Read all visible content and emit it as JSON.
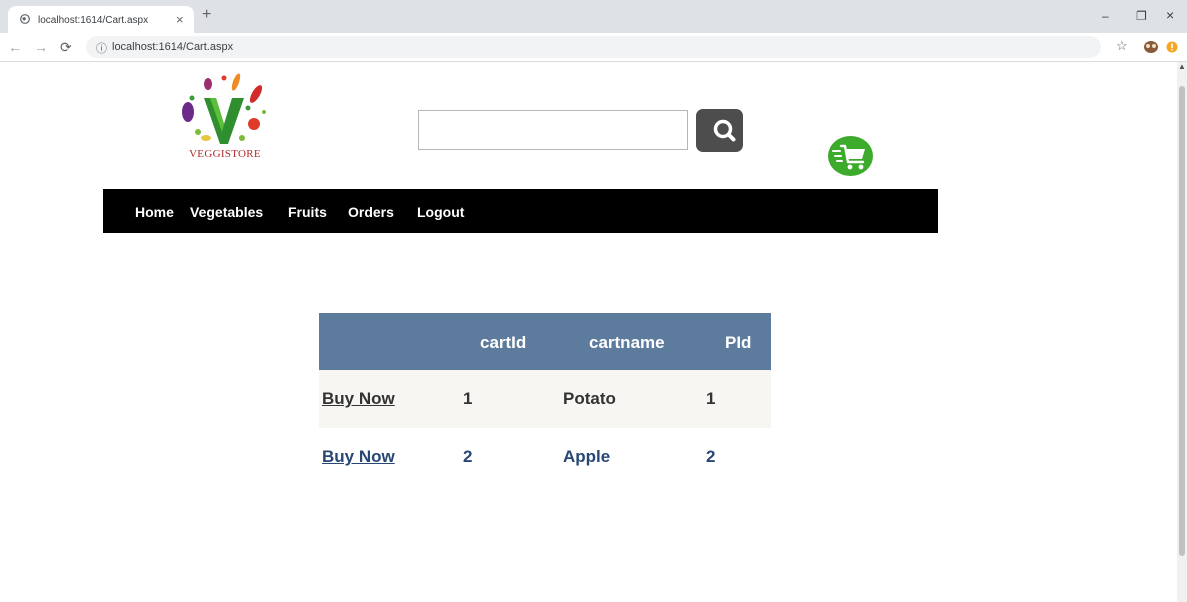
{
  "browser": {
    "tab_title": "localhost:1614/Cart.aspx",
    "tab_close": "×",
    "new_tab": "+",
    "url": "localhost:1614/Cart.aspx",
    "controls": {
      "minimize": "–",
      "restore": "❐",
      "close": "×"
    }
  },
  "site": {
    "logo_text": "VEGGISTORE",
    "search": {
      "value": "",
      "placeholder": ""
    },
    "nav": [
      "Home",
      "Vegetables",
      "Fruits",
      "Orders",
      "Logout"
    ]
  },
  "grid": {
    "headers": [
      "",
      "cartId",
      "cartname",
      "PId"
    ],
    "rows": [
      {
        "action": "Buy Now",
        "cartId": "1",
        "cartname": "Potato",
        "PId": "1"
      },
      {
        "action": "Buy Now",
        "cartId": "2",
        "cartname": "Apple",
        "PId": "2"
      }
    ]
  },
  "colors": {
    "header_bg": "#5d7b9d",
    "alt_row_bg": "#f7f6f3",
    "row1_text": "#333333",
    "row2_text": "#284775",
    "navbar_bg": "#000000",
    "cart_green": "#3cab2b"
  },
  "icons": {
    "search": "magnifier-icon",
    "cart": "shopping-cart-icon"
  }
}
